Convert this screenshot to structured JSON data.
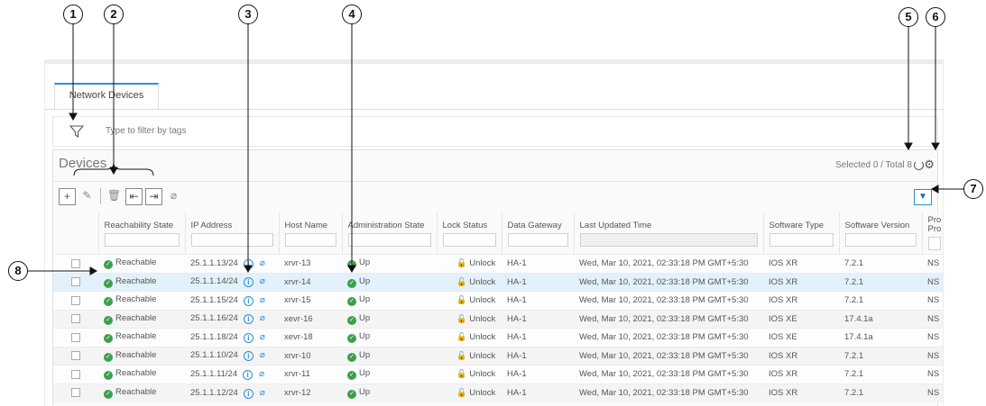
{
  "callouts": [
    "1",
    "2",
    "3",
    "4",
    "5",
    "6",
    "7",
    "8"
  ],
  "tab": {
    "label": "Network Devices"
  },
  "filter": {
    "placeholder": "Type to filter by tags"
  },
  "panel": {
    "title": "Devices",
    "selected": "Selected 0 / Total 8"
  },
  "columns": [
    "Reachability State",
    "IP Address",
    "Host Name",
    "Administration State",
    "Lock Status",
    "Data Gateway",
    "Last Updated Time",
    "Software Type",
    "Software Version",
    "Pro"
  ],
  "column_sub": "Pro",
  "rows": [
    {
      "reach": "Reachable",
      "ip": "25.1.1.13/24",
      "host": "xrvr-13",
      "admin": "Up",
      "lock": "Unlock",
      "gw": "HA-1",
      "time": "Wed, Mar 10, 2021, 02:33:18 PM GMT+5:30",
      "swtype": "IOS XR",
      "swver": "7.2.1",
      "pro": "NS"
    },
    {
      "reach": "Reachable",
      "ip": "25.1.1.14/24",
      "host": "xrvr-14",
      "admin": "Up",
      "lock": "Unlock",
      "gw": "HA-1",
      "time": "Wed, Mar 10, 2021, 02:33:18 PM GMT+5:30",
      "swtype": "IOS XR",
      "swver": "7.2.1",
      "pro": "NS"
    },
    {
      "reach": "Reachable",
      "ip": "25.1.1.15/24",
      "host": "xrvr-15",
      "admin": "Up",
      "lock": "Unlock",
      "gw": "HA-1",
      "time": "Wed, Mar 10, 2021, 02:33:18 PM GMT+5:30",
      "swtype": "IOS XR",
      "swver": "7.2.1",
      "pro": "NS"
    },
    {
      "reach": "Reachable",
      "ip": "25.1.1.16/24",
      "host": "xevr-16",
      "admin": "Up",
      "lock": "Unlock",
      "gw": "HA-1",
      "time": "Wed, Mar 10, 2021, 02:33:18 PM GMT+5:30",
      "swtype": "IOS XE",
      "swver": "17.4.1a",
      "pro": "NS"
    },
    {
      "reach": "Reachable",
      "ip": "25.1.1.18/24",
      "host": "xevr-18",
      "admin": "Up",
      "lock": "Unlock",
      "gw": "HA-1",
      "time": "Wed, Mar 10, 2021, 02:33:18 PM GMT+5:30",
      "swtype": "IOS XE",
      "swver": "17.4.1a",
      "pro": "NS"
    },
    {
      "reach": "Reachable",
      "ip": "25.1.1.10/24",
      "host": "xrvr-10",
      "admin": "Up",
      "lock": "Unlock",
      "gw": "HA-1",
      "time": "Wed, Mar 10, 2021, 02:33:18 PM GMT+5:30",
      "swtype": "IOS XR",
      "swver": "7.2.1",
      "pro": "NS"
    },
    {
      "reach": "Reachable",
      "ip": "25.1.1.11/24",
      "host": "xrvr-11",
      "admin": "Up",
      "lock": "Unlock",
      "gw": "HA-1",
      "time": "Wed, Mar 10, 2021, 02:33:18 PM GMT+5:30",
      "swtype": "IOS XR",
      "swver": "7.2.1",
      "pro": "NS"
    },
    {
      "reach": "Reachable",
      "ip": "25.1.1.12/24",
      "host": "xrvr-12",
      "admin": "Up",
      "lock": "Unlock",
      "gw": "HA-1",
      "time": "Wed, Mar 10, 2021, 02:33:18 PM GMT+5:30",
      "swtype": "IOS XR",
      "swver": "7.2.1",
      "pro": "NS"
    }
  ],
  "colors": {
    "accent": "#2b8fd6",
    "status_ok": "#3ca04a",
    "selected_row": "#e3f1fb"
  },
  "icons": [
    "filter-funnel-icon",
    "add-icon",
    "edit-icon",
    "delete-icon",
    "import-icon",
    "export-icon",
    "tag-icon",
    "refresh-icon",
    "gear-icon",
    "filter-icon",
    "check-circle-icon",
    "info-icon",
    "unlock-icon"
  ]
}
